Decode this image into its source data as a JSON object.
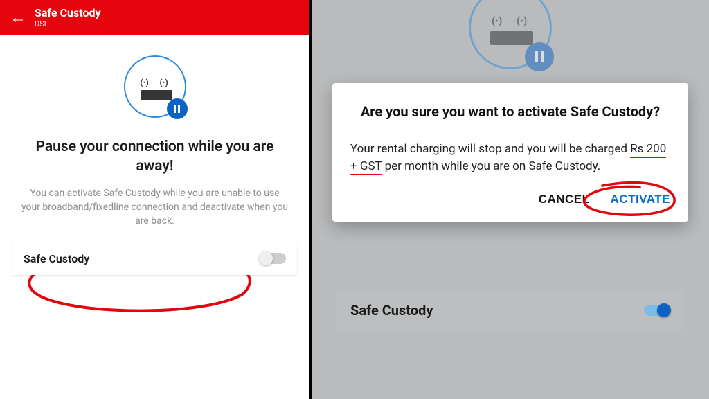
{
  "left": {
    "header": {
      "title": "Safe Custody",
      "subtitle": "DSL"
    },
    "hero": {
      "title": "Pause your connection while you are away!",
      "desc": "You can activate Safe Custody while you are unable to use your broadband/fixedline connection and deactivate when you are back."
    },
    "toggle": {
      "label": "Safe Custody",
      "on": false
    }
  },
  "right": {
    "dialog": {
      "title": "Are you sure you want to activate Safe Custody?",
      "body_pre": "Your rental charging will stop and you will be charged ",
      "body_highlight": "Rs 200 + GST",
      "body_post": " per month while you are on Safe Custody.",
      "cancel": "CANCEL",
      "activate": "ACTIVATE"
    },
    "bg_toggle": {
      "label": "Safe Custody",
      "on": true
    }
  },
  "colors": {
    "brand_red": "#e4050d",
    "accent_blue": "#0a6acc"
  }
}
